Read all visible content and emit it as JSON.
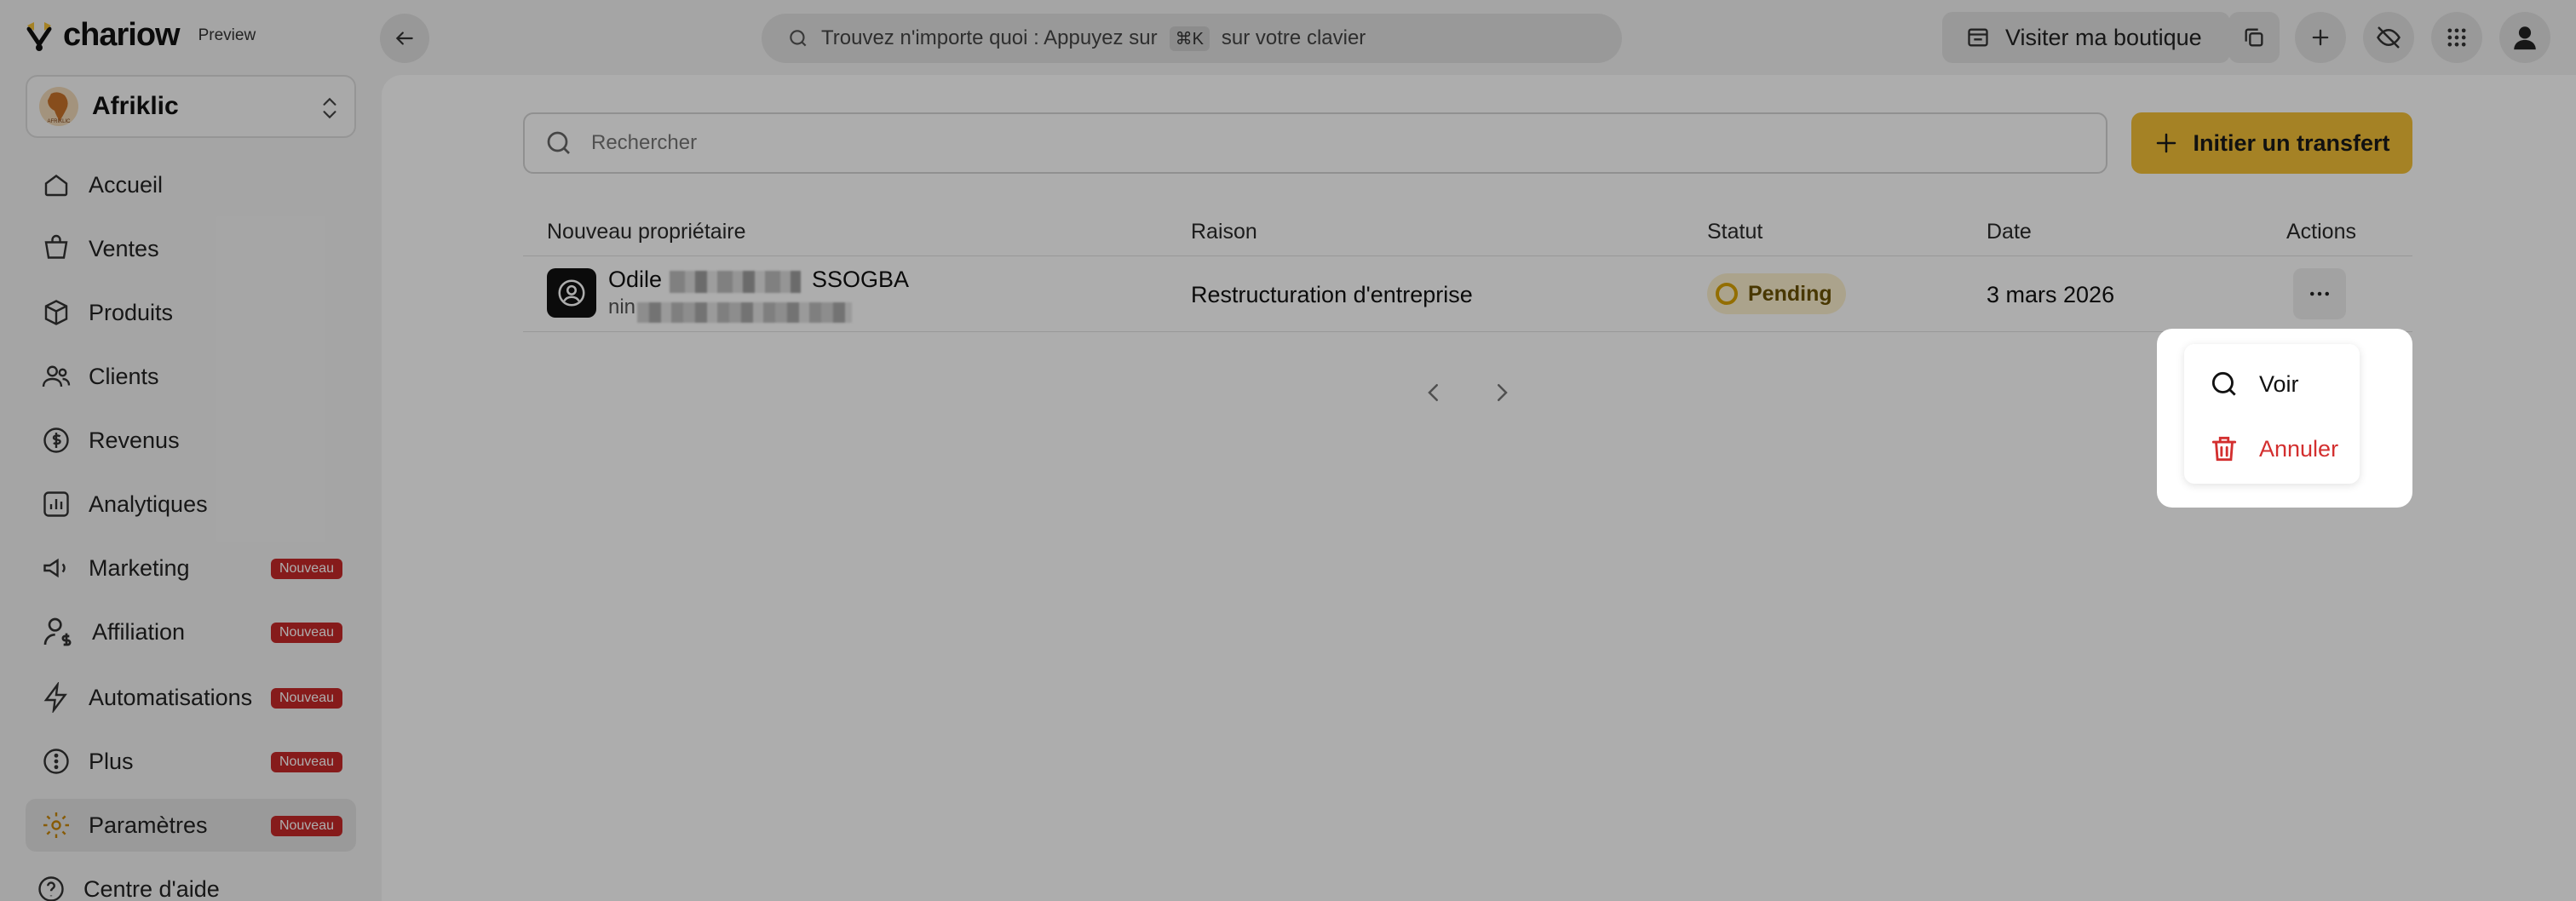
{
  "topbar": {
    "logo_text": "chariow",
    "preview_label": "Preview",
    "search_prefix": "Trouvez n'importe quoi : Appuyez sur",
    "search_kbd": "⌘K",
    "search_suffix": "sur votre clavier",
    "visit_shop_label": "Visiter ma boutique",
    "icons": [
      "arrow-left-icon",
      "search-icon",
      "store-icon",
      "copy-icon",
      "plus-icon",
      "eye-off-icon",
      "apps-grid-icon",
      "user-avatar-icon"
    ]
  },
  "store": {
    "name": "Afriklic",
    "logo_text": "AFRIKLIC"
  },
  "sidebar": {
    "items": [
      {
        "label": "Accueil",
        "icon": "home-icon",
        "badge": ""
      },
      {
        "label": "Ventes",
        "icon": "cart-icon",
        "badge": ""
      },
      {
        "label": "Produits",
        "icon": "box-icon",
        "badge": ""
      },
      {
        "label": "Clients",
        "icon": "users-icon",
        "badge": ""
      },
      {
        "label": "Revenus",
        "icon": "money-icon",
        "badge": ""
      },
      {
        "label": "Analytiques",
        "icon": "chart-icon",
        "badge": ""
      },
      {
        "label": "Marketing",
        "icon": "megaphone-icon",
        "badge": "Nouveau"
      },
      {
        "label": "Affiliation",
        "icon": "affiliate-icon",
        "badge": "Nouveau"
      },
      {
        "label": "Automatisations",
        "icon": "bolt-icon",
        "badge": "Nouveau"
      },
      {
        "label": "Plus",
        "icon": "more-circle-icon",
        "badge": "Nouveau"
      },
      {
        "label": "Paramètres",
        "icon": "gear-icon",
        "badge": "Nouveau",
        "active": true
      },
      {
        "label": "Centre d'aide",
        "icon": "help-icon",
        "badge": ""
      }
    ]
  },
  "main": {
    "search_placeholder": "Rechercher",
    "transfer_button": "Initier un transfert",
    "columns": [
      "Nouveau propriétaire",
      "Raison",
      "Statut",
      "Date",
      "Actions"
    ],
    "rows": [
      {
        "owner_name": "Odile",
        "owner_name_suffix": "SSOGBA",
        "owner_email_prefix": "nin",
        "reason": "Restructuration d'entreprise",
        "status": "Pending",
        "date": "3 mars 2026"
      }
    ]
  },
  "action_menu": {
    "view_label": "Voir",
    "cancel_label": "Annuler"
  },
  "colors": {
    "accent": "#f4c037",
    "danger": "#d32f2f",
    "badge": "#c62828",
    "pending_bg": "#fdf1cf",
    "pending_ring": "#d9a300"
  }
}
